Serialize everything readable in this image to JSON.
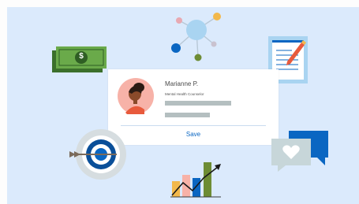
{
  "profile_card": {
    "name": "Marianne P.",
    "role": "Mental Health Counselor",
    "save_label": "Save"
  },
  "colors": {
    "background": "#dbeafc",
    "accent_blue": "#0a66c2",
    "money_green": "#4c8a3a",
    "placeholder_gray": "#b4bfc0"
  },
  "money_icon": {
    "symbol": "$"
  }
}
